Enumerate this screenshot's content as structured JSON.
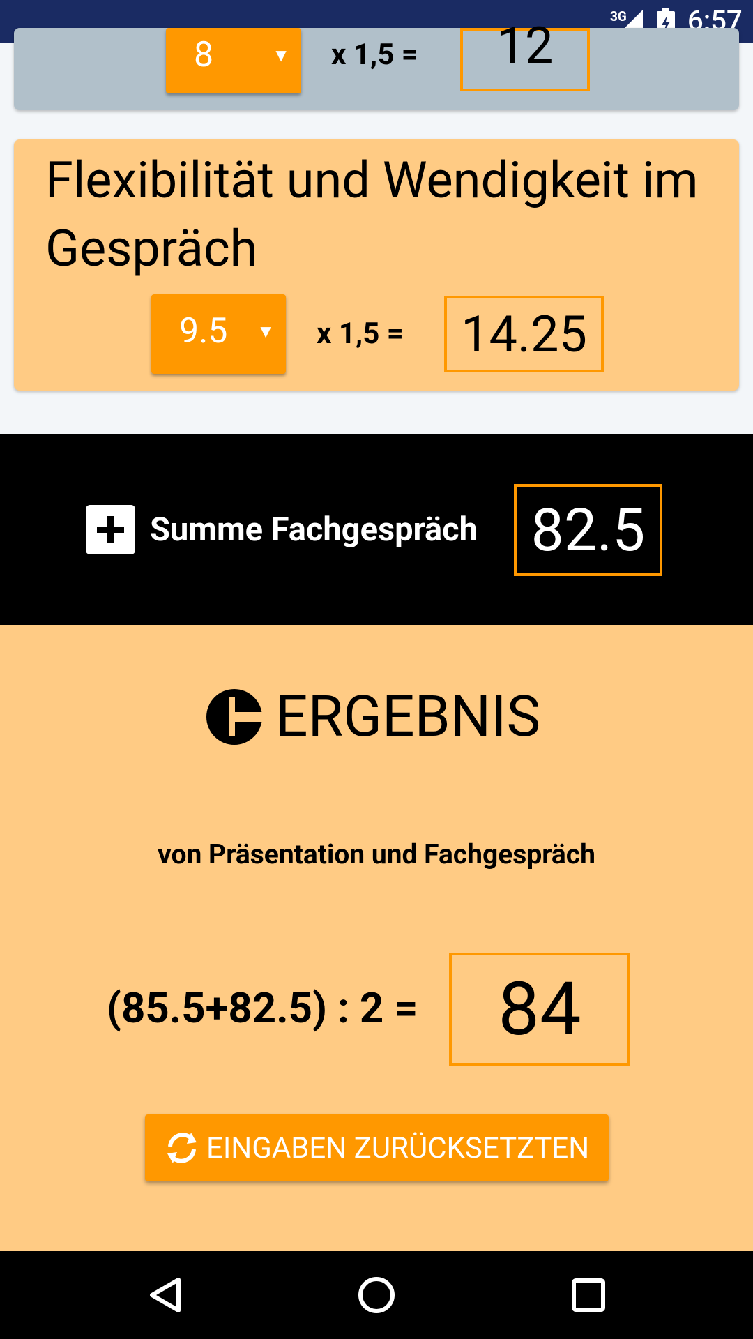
{
  "status_bar": {
    "network": "3G",
    "time": "6:57"
  },
  "card_top": {
    "select_value": "8",
    "multiplier_text": "x 1,5 =",
    "result": "12"
  },
  "card_flex": {
    "title": "Flexibilität und Wendigkeit im Gespräch",
    "select_value": "9.5",
    "multiplier_text": "x 1,5 =",
    "result": "14.25"
  },
  "sum": {
    "label": "Summe Fachgespräch",
    "value": "82.5"
  },
  "result": {
    "title": "ERGEBNIS",
    "subtitle": "von Präsentation und Fachgespräch",
    "formula": "(85.5+82.5) : 2 =",
    "value": "84",
    "reset_label": "EINGABEN ZURÜCKSETZTEN"
  },
  "colors": {
    "accent": "#ff9800",
    "card_peach": "#ffcb84",
    "card_gray": "#b1c0ca",
    "status_bar": "#1a2b63"
  },
  "icons": [
    "signal-icon",
    "battery-icon",
    "plus-icon",
    "ergebnis-icon",
    "refresh-icon",
    "back-icon",
    "home-icon",
    "recents-icon"
  ]
}
